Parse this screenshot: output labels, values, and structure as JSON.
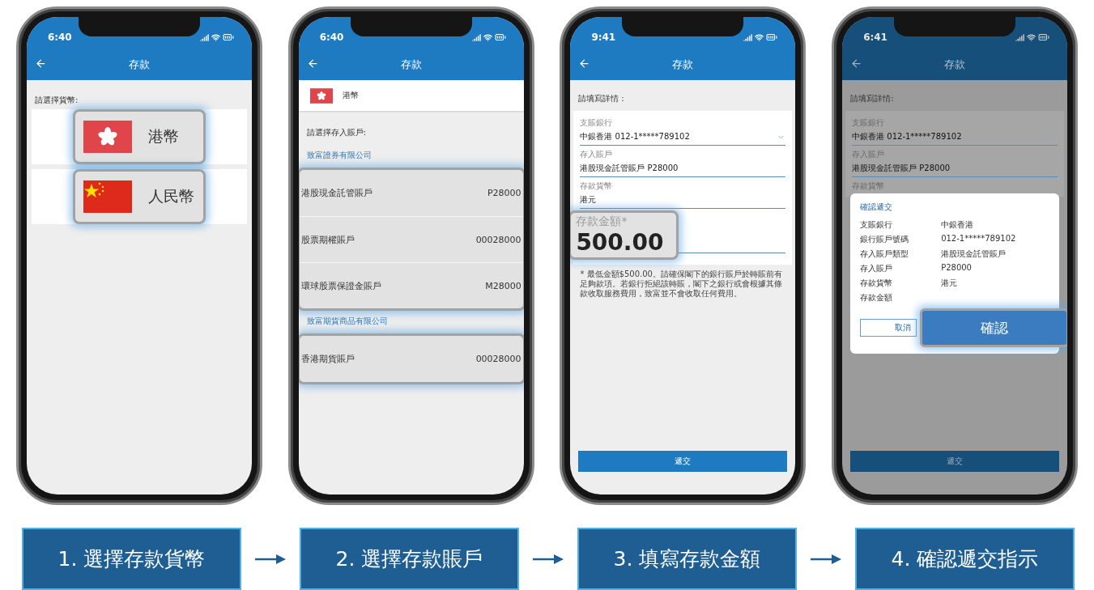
{
  "phones": [
    {
      "kind": "currency",
      "dimmed": false,
      "time": "6:40",
      "title": "存款",
      "prompt": "請選擇貨幣:",
      "currencies": [
        {
          "kind": "hk",
          "label": "港幣"
        },
        {
          "kind": "cn",
          "label": "人民幣"
        }
      ]
    },
    {
      "kind": "accounts",
      "dimmed": false,
      "time": "6:40",
      "title": "存款",
      "currency": {
        "kind": "hk",
        "label": "港幣"
      },
      "prompt": "請選擇存入賬戶:",
      "groups": [
        {
          "company": "致富證券有限公司",
          "accounts": [
            {
              "name": "港股現金託管賬戶",
              "number": "P28000"
            },
            {
              "name": "股票期權賬戶",
              "number": "00028000"
            },
            {
              "name": "環球股票保證金賬戶",
              "number": "M28000"
            }
          ]
        },
        {
          "company": "致富期貨商品有限公司",
          "accounts": [
            {
              "name": "香港期貨賬戶",
              "number": "00028000"
            }
          ]
        }
      ]
    },
    {
      "kind": "form",
      "dimmed": false,
      "time": "9:41",
      "title": "存款",
      "prompt": "請填寫詳情：",
      "fields": [
        {
          "kind": "select",
          "label": "支賬銀行",
          "value": "中銀香港 012-1*****789102"
        },
        {
          "kind": "text",
          "label": "存入賬戶",
          "value": "港股現金託管賬戶 P28000"
        },
        {
          "kind": "text",
          "label": "存款貨幣",
          "value": "港元"
        }
      ],
      "amount": {
        "label": "存款金額*",
        "value": "500.00"
      },
      "note": "* 最低金額$500.00。請確保閣下的銀行賬戶於轉賬前有足夠款項。若銀行拒絕該轉賬，閣下之銀行或會根據其條款收取服務費用，致富並不會收取任何費用。",
      "submit": "遞交"
    },
    {
      "kind": "form",
      "dimmed": true,
      "time": "6:41",
      "title": "存款",
      "prompt": "請填寫詳情:",
      "fields": [
        {
          "kind": "select",
          "label": "支賬銀行",
          "value": "中銀香港 012-1*****789102"
        },
        {
          "kind": "text",
          "label": "存入賬戶",
          "value": "港股現金託管賬戶 P28000"
        },
        {
          "label": "存款貨幣"
        }
      ],
      "dialog": {
        "title": "確認遞交",
        "rows": [
          {
            "label": "支賬銀行",
            "value": "中銀香港"
          },
          {
            "label": "銀行賬戶號碼",
            "value": "012-1*****789102"
          },
          {
            "label": "存入賬戶類型",
            "value": "港股現金託管賬戶"
          },
          {
            "label": "存入賬戶",
            "value": "P28000"
          },
          {
            "label": "存款貨幣",
            "value": "港元"
          },
          {
            "label": "存款金額"
          }
        ],
        "cancel": "取消",
        "confirm": "確認"
      },
      "submit": "遞交"
    }
  ],
  "steps": [
    {
      "label": "1. 選擇存款貨幣"
    },
    {
      "label": "2. 選擇存款賬戶"
    },
    {
      "label": "3. 填寫存款金額"
    },
    {
      "label": "4. 確認遞交指示"
    }
  ]
}
